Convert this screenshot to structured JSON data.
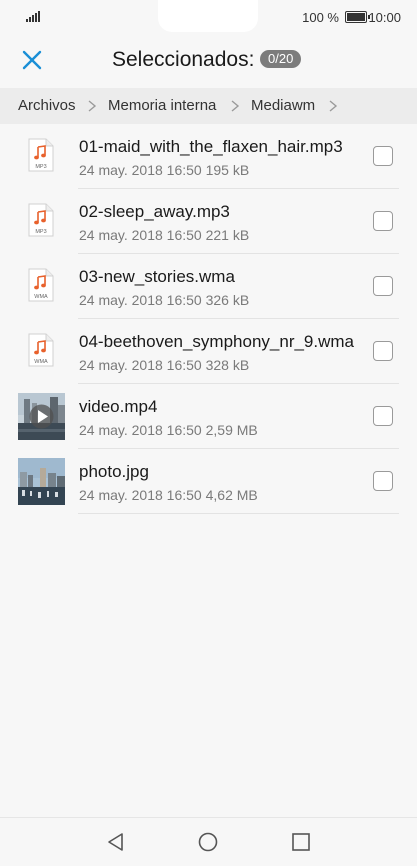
{
  "status": {
    "battery_text": "100 %",
    "battery_level": 1.0,
    "time": "10:00"
  },
  "header": {
    "close_icon": "close-icon",
    "title": "Seleccionados:",
    "count": "0/20"
  },
  "breadcrumb": [
    "Archivos",
    "Memoria interna",
    "Mediawm"
  ],
  "files": [
    {
      "name": "01-maid_with_the_flaxen_hair.mp3",
      "meta": "24 may. 2018 16:50 195 kB",
      "icon": "MP3",
      "checked": false
    },
    {
      "name": "02-sleep_away.mp3",
      "meta": "24 may. 2018 16:50 221 kB",
      "icon": "MP3",
      "checked": false
    },
    {
      "name": "03-new_stories.wma",
      "meta": "24 may. 2018 16:50 326 kB",
      "icon": "WMA",
      "checked": false
    },
    {
      "name": "04-beethoven_symphony_nr_9.wma",
      "meta": "24 may. 2018 16:50 328 kB",
      "icon": "WMA",
      "checked": false
    },
    {
      "name": "video.mp4",
      "meta": "24 may. 2018 16:50 2,59 MB",
      "icon": "video-thumbnail",
      "checked": false
    },
    {
      "name": "photo.jpg",
      "meta": "24 may. 2018 16:50 4,62 MB",
      "icon": "photo-thumbnail",
      "checked": false
    }
  ],
  "colors": {
    "accent": "#1a8fd6",
    "music_note": "#e8612c",
    "background": "#f7f7f7",
    "breadcrumb_bg": "#ececec",
    "badge_bg": "#7c7c7c"
  },
  "navbar": {
    "back_icon": "back-triangle-icon",
    "home_icon": "home-circle-icon",
    "recents_icon": "recents-square-icon"
  }
}
